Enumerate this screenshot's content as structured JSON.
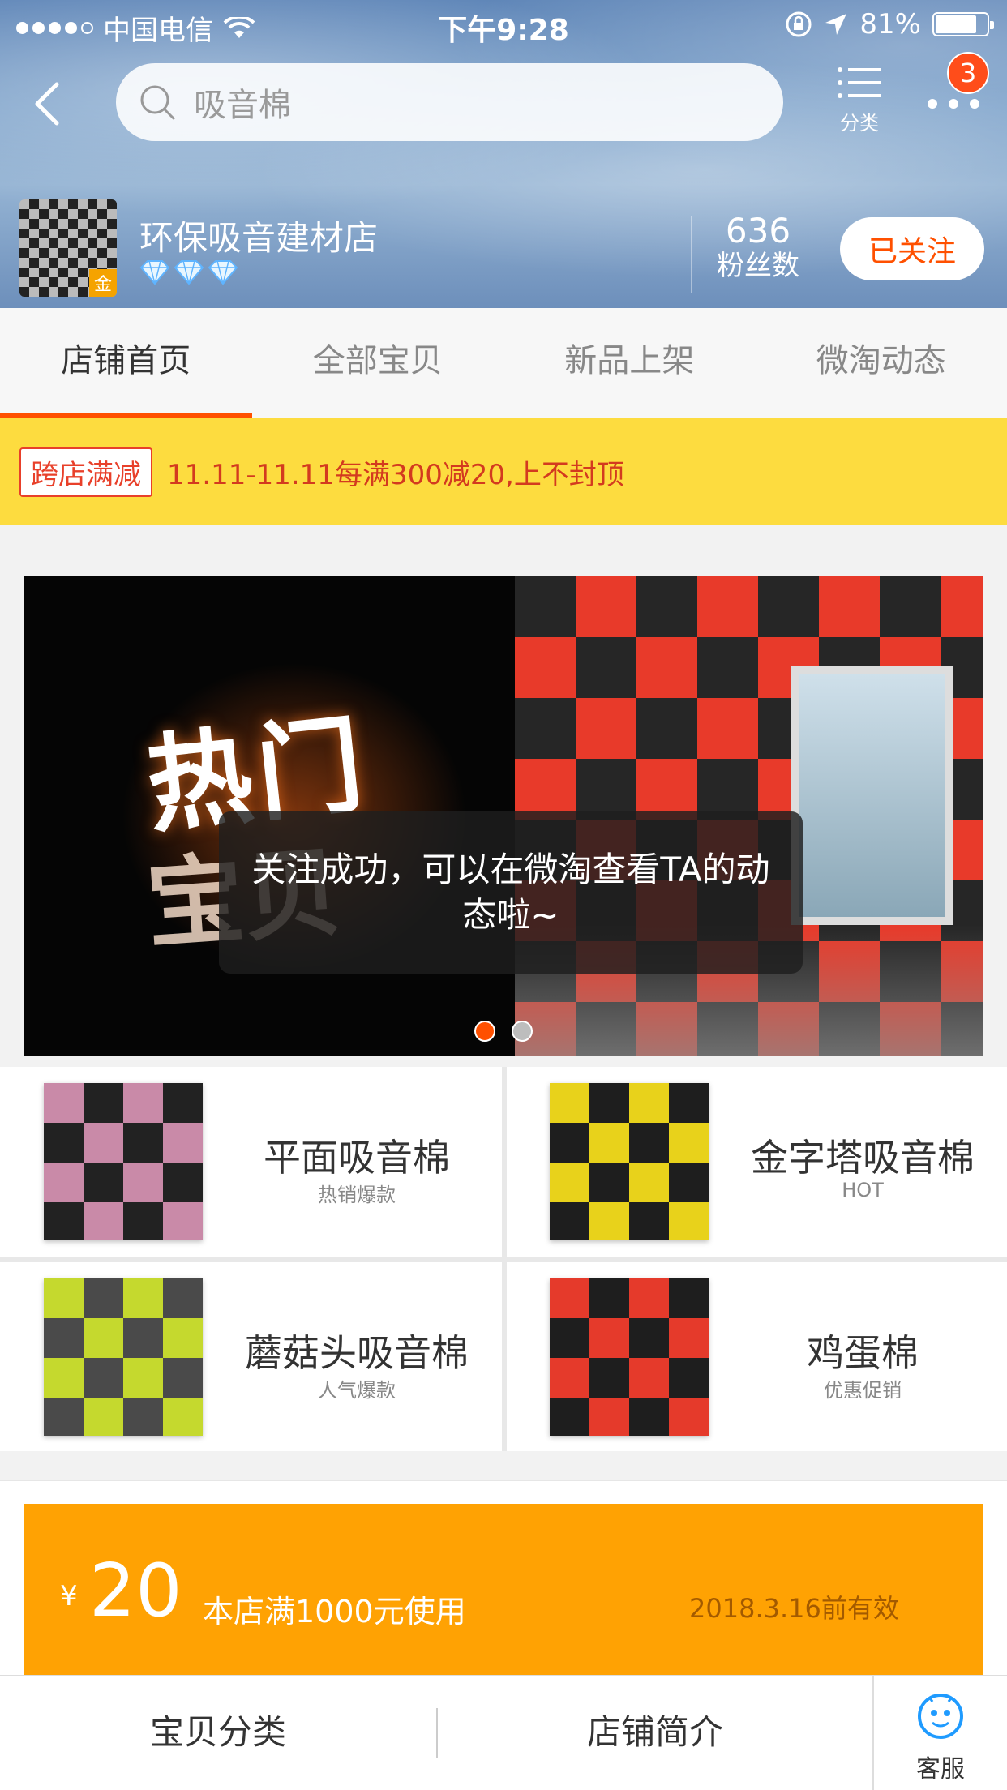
{
  "status_bar": {
    "carrier": "中国电信",
    "time": "下午9:28",
    "battery": "81%",
    "battery_level": 0.81
  },
  "nav": {
    "search_placeholder": "吸音棉",
    "category_label": "分类",
    "badge_count": "3"
  },
  "shop": {
    "name": "环保吸音建材店",
    "gold_label": "金",
    "fans_count": "636",
    "fans_label": "粉丝数",
    "follow_label": "已关注"
  },
  "tabs": [
    {
      "label": "店铺首页",
      "active": true
    },
    {
      "label": "全部宝贝",
      "active": false
    },
    {
      "label": "新品上架",
      "active": false
    },
    {
      "label": "微淘动态",
      "active": false
    }
  ],
  "promo": {
    "tag": "跨店满减",
    "text": "11.11-11.11每满300减20,上不封顶"
  },
  "banner": {
    "hot_text_line1": "热门",
    "hot_text_line2": "宝贝",
    "toast": "关注成功，可以在微淘查看TA的动态啦~",
    "page_count": 2,
    "current_page": 1
  },
  "categories": [
    {
      "title": "平面吸音棉",
      "subtitle": "热销爆款",
      "colors": [
        "#222222",
        "#c98aa8"
      ]
    },
    {
      "title": "金字塔吸音棉",
      "subtitle": "HOT",
      "colors": [
        "#1e1e1e",
        "#e8d21b"
      ]
    },
    {
      "title": "蘑菇头吸音棉",
      "subtitle": "人气爆款",
      "colors": [
        "#4a4a4a",
        "#c5d92e"
      ]
    },
    {
      "title": "鸡蛋棉",
      "subtitle": "优惠促销",
      "colors": [
        "#1e1e1e",
        "#e53a2b"
      ]
    }
  ],
  "coupon": {
    "currency": "¥",
    "amount": "20",
    "condition": "本店满1000元使用",
    "valid_until": "2018.3.16前有效"
  },
  "bottom_bar": {
    "item1": "宝贝分类",
    "item2": "店铺简介",
    "service": "客服"
  },
  "colors": {
    "accent": "#ff5000",
    "promo_bg": "#fddc3f",
    "coupon_bg": "#ffa203"
  }
}
